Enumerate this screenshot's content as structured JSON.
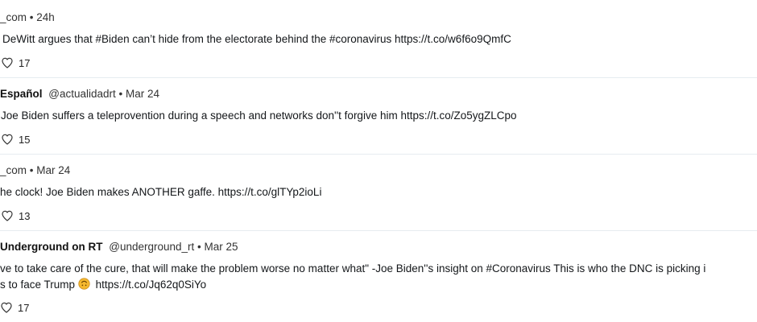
{
  "tweets": [
    {
      "author": "",
      "handle": "_com",
      "separator": "•",
      "time": "24h",
      "text": "DeWitt argues that #Biden can’t hide from the electorate behind the #coronavirus https://t.co/w6f6o9QmfC",
      "likes": "17"
    },
    {
      "author": "Español",
      "handle": "@actualidadrt",
      "separator": "•",
      "time": "Mar 24",
      "text": "Joe Biden suffers a teleprovention during a speech and networks don''t forgive him https://t.co/Zo5ygZLCpo",
      "likes": "15"
    },
    {
      "author": "",
      "handle": "_com",
      "separator": "•",
      "time": "Mar 24",
      "text": "he clock! Joe Biden makes ANOTHER gaffe. https://t.co/glTYp2ioLi",
      "likes": "13"
    },
    {
      "author": "Underground on RT",
      "handle": "@underground_rt",
      "separator": "•",
      "time": "Mar 25",
      "text_line1": "ve to take care of the cure, that will make the problem worse no matter what\" -Joe Biden''s insight on #Coronavirus This is who the DNC is picking i",
      "text_line2_before": "s to face Trump",
      "text_line2_emoji": "upside-down-face-emoji",
      "text_line2_after": "https://t.co/Jq62q0SiYo",
      "likes": "17"
    }
  ],
  "icons": {
    "like": "heart-outline-icon"
  },
  "colors": {
    "divider": "#e6ecf0",
    "text": "#14171a",
    "emoji": "#f5b82e"
  }
}
